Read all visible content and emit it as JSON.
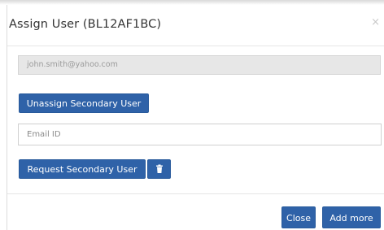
{
  "dialog": {
    "title": "Assign User (BL12AF1BC)",
    "close_symbol": "×"
  },
  "secondary_user": {
    "email_value": "john.smith@yahoo.com",
    "unassign_label": "Unassign Secondary User"
  },
  "request": {
    "email_placeholder": "Email ID",
    "request_label": "Request Secondary User",
    "delete_icon": "trash-icon"
  },
  "footer": {
    "close_label": "Close",
    "add_more_label": "Add more"
  },
  "colors": {
    "primary_button": "#2f62a8",
    "readonly_bg": "#e7e7e7"
  }
}
